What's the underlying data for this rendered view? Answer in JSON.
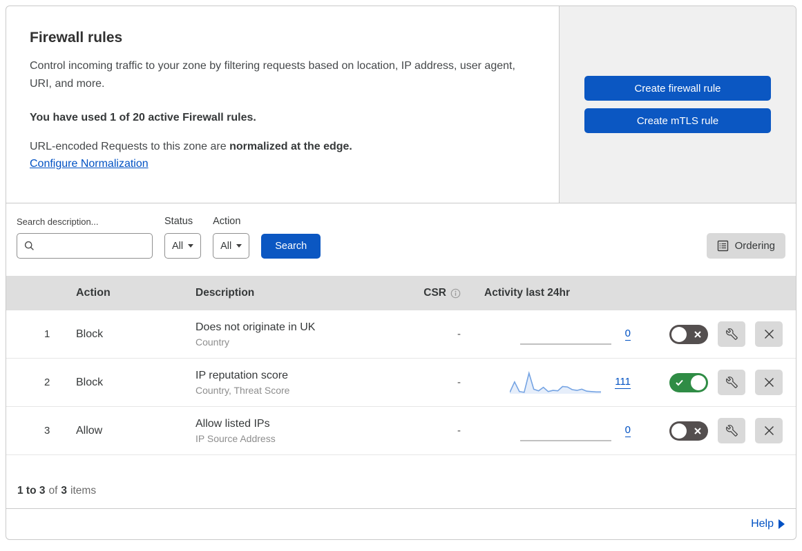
{
  "panel": {
    "title": "Firewall rules",
    "description": "Control incoming traffic to your zone by filtering requests based on location, IP address, user agent, URI, and more.",
    "usage_line": "You have used 1 of 20 active Firewall rules.",
    "normalization_text": "URL-encoded Requests to this zone are ",
    "normalization_bold": "normalized at the edge.",
    "normalization_link": "Configure Normalization",
    "create_firewall_button": "Create firewall rule",
    "create_mtls_button": "Create mTLS rule"
  },
  "filters": {
    "search_label": "Search description...",
    "status_label": "Status",
    "status_value": "All",
    "action_label": "Action",
    "action_value": "All",
    "search_button": "Search",
    "ordering_button": "Ordering"
  },
  "table": {
    "headers": {
      "action": "Action",
      "description": "Description",
      "csr": "CSR",
      "activity": "Activity last 24hr"
    },
    "rows": [
      {
        "index": "1",
        "action": "Block",
        "description": "Does not originate in UK",
        "criteria": "Country",
        "csr": "-",
        "activity_count": "0",
        "enabled": false,
        "sparkline": [
          0,
          0,
          0,
          0,
          0,
          0,
          0,
          0,
          0,
          0,
          0,
          0,
          0,
          0,
          0,
          0,
          0,
          0,
          0,
          0
        ]
      },
      {
        "index": "2",
        "action": "Block",
        "description": "IP reputation score",
        "criteria": "Country, Threat Score",
        "csr": "-",
        "activity_count": "111",
        "enabled": true,
        "sparkline": [
          2,
          29,
          4,
          2,
          52,
          10,
          6,
          15,
          4,
          7,
          6,
          17,
          16,
          9,
          7,
          10,
          5,
          4,
          3,
          3
        ]
      },
      {
        "index": "3",
        "action": "Allow",
        "description": "Allow listed IPs",
        "criteria": "IP Source Address",
        "csr": "-",
        "activity_count": "0",
        "enabled": false,
        "sparkline": [
          0,
          0,
          0,
          0,
          0,
          0,
          0,
          0,
          0,
          0,
          0,
          0,
          0,
          0,
          0,
          0,
          0,
          0,
          0,
          0
        ]
      }
    ]
  },
  "footer": {
    "range": "1 to 3",
    "of_text": "of",
    "total": "3",
    "items_text": "items",
    "help": "Help"
  },
  "colors": {
    "accent_blue": "#0b57c2",
    "link_blue": "#0051c3",
    "toggle_on_green": "#2f8c45",
    "toggle_off_gray": "#544f4f",
    "header_bg": "#dedede",
    "side_panel_bg": "#f0f0f0",
    "sparkline_line": "#74a3e3",
    "sparkline_fill": "rgba(116,163,227,0.18)",
    "flat_line_gray": "#9a9a9a"
  }
}
